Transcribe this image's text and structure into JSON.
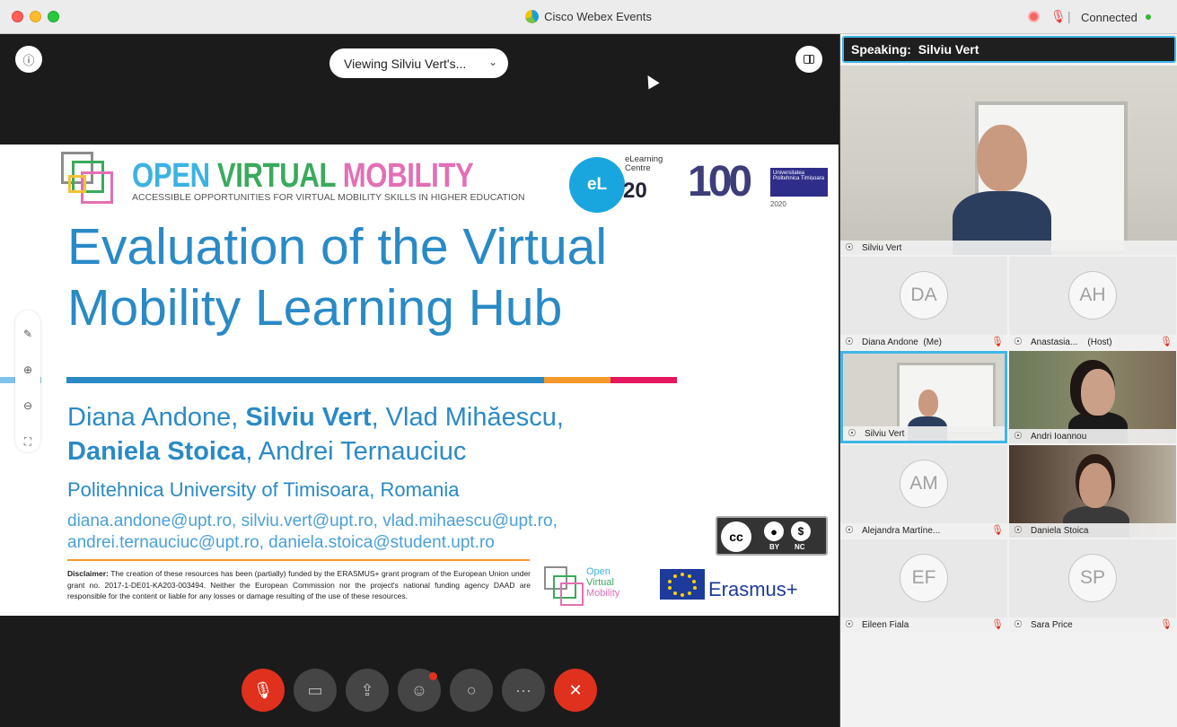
{
  "window": {
    "title": "Cisco Webex Events",
    "status": "Connected"
  },
  "stage": {
    "viewing": "Viewing Silviu Vert's...",
    "info_icon": "info-icon",
    "layout_icon": "layout-icon"
  },
  "slide": {
    "brand_title_parts": [
      {
        "text": "OPEN ",
        "color": "#3bb3e3"
      },
      {
        "text": "VIRTUAL ",
        "color": "#3aaa5c"
      },
      {
        "text": "MOBILITY",
        "color": "#e36fb5"
      }
    ],
    "brand_subtitle": "ACCESSIBLE OPPORTUNITIES FOR VIRTUAL MOBILITY SKILLS IN HIGHER EDUCATION",
    "elc_label_1": "eLearning",
    "elc_label_2": "Centre",
    "elc_mark": "eL",
    "elc_20": "20",
    "upt_100": "100",
    "upt_box": "Universitatea Politehnica Timișoara",
    "upt_year": "2020",
    "title_line1": "Evaluation of the Virtual",
    "title_line2": "Mobility Learning Hub",
    "author_1": "Diana Andone, ",
    "author_2": "Silviu Vert",
    "author_3": ", Vlad Mihăescu,",
    "author_4": "Daniela Stoica",
    "author_5": ", Andrei Ternauciuc",
    "university": "Politehnica University of Timisoara, Romania",
    "emails_line1": "diana.andone@upt.ro, silviu.vert@upt.ro, vlad.mihaescu@upt.ro,",
    "emails_line2": "andrei.ternauciuc@upt.ro, daniela.stoica@student.upt.ro",
    "disclaimer_label": "Disclaimer:",
    "disclaimer_text": " The creation of these resources has been (partially) funded by the ERASMUS+ grant program of the European Union under grant no. 2017-1-DE01-KA203-003494. Neither the European Commission nor the project's national funding agency DAAD are responsible for the content or liable for any losses or damage resulting of the use of these resources.",
    "cc_label": "cc",
    "cc_by": "BY",
    "cc_nc": "NC",
    "ovm_small_1": "Open",
    "ovm_small_2": "Virtual",
    "ovm_small_3": "Mobility",
    "erasmus": "Erasmus+"
  },
  "panel": {
    "speaking_label": "Speaking:",
    "speaking_name": "Silviu Vert",
    "main_name": "Silviu Vert",
    "participants": [
      {
        "initials": "DA",
        "name": "Diana Andone",
        "tag": "(Me)",
        "muted": true
      },
      {
        "initials": "AH",
        "name": "Anastasia...",
        "tag": "(Host)",
        "muted": true
      },
      {
        "initials": "",
        "name": "Silviu Vert",
        "tag": "",
        "muted": false
      },
      {
        "initials": "",
        "name": "Andri Ioannou",
        "tag": "",
        "muted": false
      },
      {
        "initials": "AM",
        "name": "Alejandra Martíne...",
        "tag": "",
        "muted": true
      },
      {
        "initials": "",
        "name": "Daniela Stoica",
        "tag": "",
        "muted": false
      },
      {
        "initials": "EF",
        "name": "Eileen Fiala",
        "tag": "",
        "muted": true
      },
      {
        "initials": "SP",
        "name": "Sara Price",
        "tag": "",
        "muted": true
      }
    ]
  },
  "colors": {
    "accent": "#3fb6e8",
    "end_red": "#e0301e",
    "slide_blue": "#2a8ac6"
  }
}
